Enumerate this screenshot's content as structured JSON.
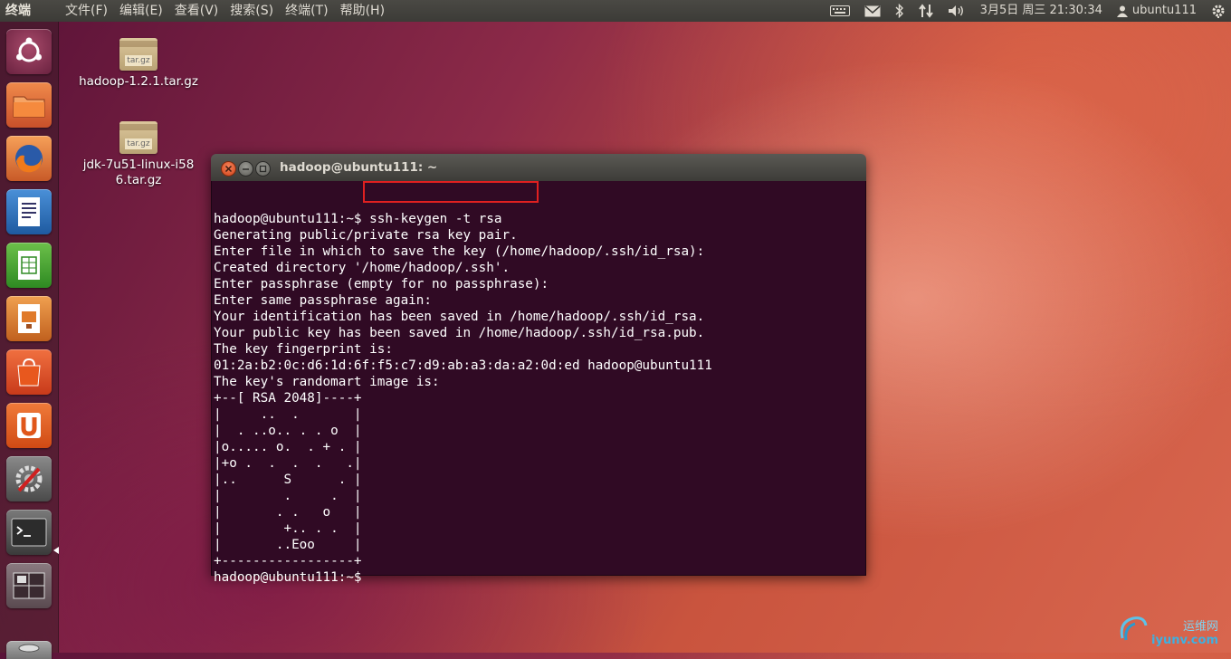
{
  "top_panel": {
    "app_title": "终端",
    "menu": [
      "文件(F)",
      "编辑(E)",
      "查看(V)",
      "搜索(S)",
      "终端(T)",
      "帮助(H)"
    ],
    "clock": "3月5日 周三 21:30:34",
    "user": "ubuntu111"
  },
  "desktop_icons": [
    {
      "label": "hadoop-1.2.1.tar.gz",
      "badge": "tar.gz"
    },
    {
      "label": "jdk-7u51-linux-i586.tar.gz",
      "badge": "tar.gz"
    }
  ],
  "terminal": {
    "title": "hadoop@ubuntu111: ~",
    "prompt": "hadoop@ubuntu111:~$",
    "command": " ssh-keygen -t rsa",
    "lines": [
      "Generating public/private rsa key pair.",
      "Enter file in which to save the key (/home/hadoop/.ssh/id_rsa):",
      "Created directory '/home/hadoop/.ssh'.",
      "Enter passphrase (empty for no passphrase):",
      "Enter same passphrase again:",
      "Your identification has been saved in /home/hadoop/.ssh/id_rsa.",
      "Your public key has been saved in /home/hadoop/.ssh/id_rsa.pub.",
      "The key fingerprint is:",
      "01:2a:b2:0c:d6:1d:6f:f5:c7:d9:ab:a3:da:a2:0d:ed hadoop@ubuntu111",
      "The key's randomart image is:",
      "+--[ RSA 2048]----+",
      "|     ..  .       |",
      "|  . ..o.. . . o  |",
      "|o..... o.  . + . |",
      "|+o .  .  .  .   .|",
      "|..      S      . |",
      "|        .     .  |",
      "|       . .   o   |",
      "|        +.. . .  |",
      "|       ..Eoo     |",
      "+-----------------+"
    ],
    "final_prompt": "hadoop@ubuntu111:~$"
  },
  "watermark": {
    "line1": "运维网",
    "line2": "iyunv.com"
  },
  "colors": {
    "terminal_bg": "#300a24",
    "highlight": "#e02020",
    "panel_bg": "#3c3b37"
  }
}
